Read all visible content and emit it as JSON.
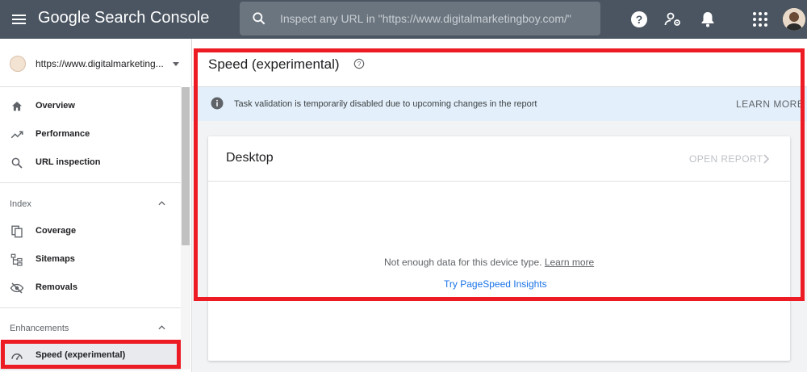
{
  "app": {
    "title": "Google Search Console"
  },
  "search": {
    "placeholder": "Inspect any URL in \"https://www.digitalmarketingboy.com/\""
  },
  "property": {
    "url": "https://www.digitalmarketing..."
  },
  "sidebar": {
    "items": [
      {
        "label": "Overview",
        "icon": "home-icon"
      },
      {
        "label": "Performance",
        "icon": "trending-up-icon"
      },
      {
        "label": "URL inspection",
        "icon": "search-icon"
      }
    ],
    "index": {
      "heading": "Index",
      "items": [
        {
          "label": "Coverage",
          "icon": "copy-icon"
        },
        {
          "label": "Sitemaps",
          "icon": "sitemap-icon"
        },
        {
          "label": "Removals",
          "icon": "visibility-off-icon"
        }
      ]
    },
    "enhancements": {
      "heading": "Enhancements",
      "items": [
        {
          "label": "Speed (experimental)",
          "icon": "speedometer-icon"
        }
      ]
    }
  },
  "main": {
    "title": "Speed (experimental)",
    "banner": {
      "message": "Task validation is temporarily disabled due to upcoming changes in the report",
      "action": "LEARN MORE"
    },
    "card": {
      "title": "Desktop",
      "open_report": "OPEN REPORT",
      "no_data": "Not enough data for this device type.",
      "learn_more": "Learn more",
      "psi_link": "Try PageSpeed Insights"
    }
  },
  "colors": {
    "topbar": "#4a5561",
    "annotation": "#ed1c24",
    "link": "#1a73e8",
    "banner": "#e3f0fb"
  }
}
